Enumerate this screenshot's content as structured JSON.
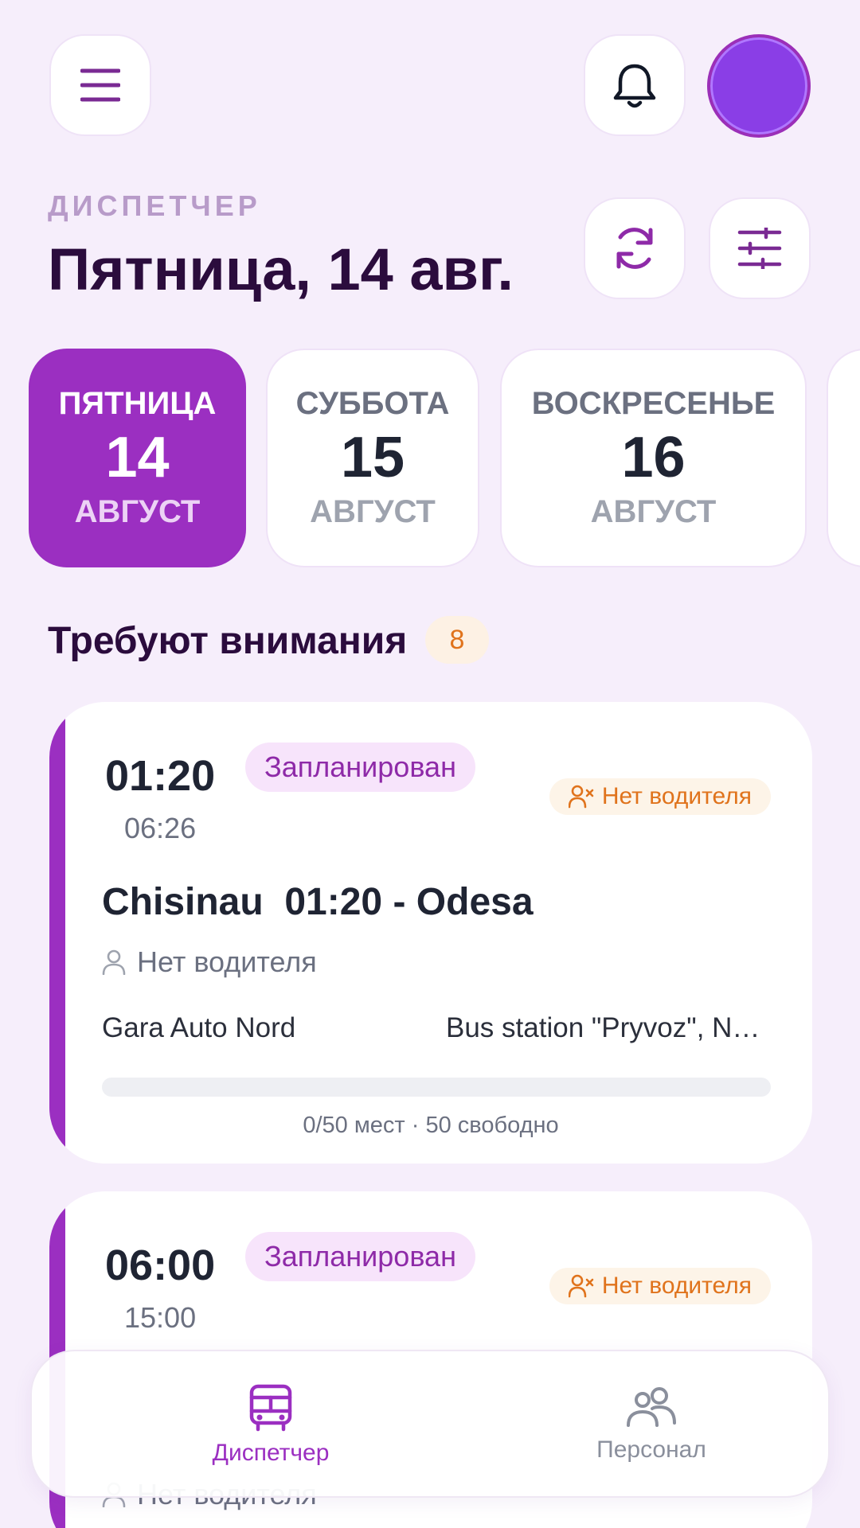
{
  "header": {
    "eyebrow": "ДИСПЕТЧЕР",
    "title": "Пятница, 14 авг.",
    "icons": [
      "menu-icon",
      "bell-icon",
      "refresh-icon",
      "sliders-icon"
    ],
    "avatar_color": "#8a3ee6"
  },
  "days": [
    {
      "name": "ПЯТНИЦА",
      "num": "14",
      "month": "АВГУСТ",
      "active": true
    },
    {
      "name": "СУББОТА",
      "num": "15",
      "month": "АВГУСТ",
      "active": false
    },
    {
      "name": "ВОСКРЕСЕНЬЕ",
      "num": "16",
      "month": "АВГУСТ",
      "active": false
    }
  ],
  "attention": {
    "title": "Требуют внимания",
    "count": "8"
  },
  "trips": [
    {
      "time": "01:20",
      "end_time": "06:26",
      "status": "Запланирован",
      "badge": "Нет водителя",
      "route": "Chisinau  01:20 - Odesa",
      "driver": "Нет водителя",
      "from": "Gara Auto Nord",
      "to": "Bus station \"Pryvoz\", Novoshchepnyi Riad Street",
      "seats_text": "0/50 мест · 50 свободно",
      "occupancy": 0
    },
    {
      "time": "06:00",
      "end_time": "15:00",
      "status": "Запланирован",
      "badge": "Нет водителя",
      "driver": "Нет водителя"
    }
  ],
  "nav": [
    {
      "label": "Диспетчер",
      "icon": "bus-icon",
      "active": true
    },
    {
      "label": "Персонал",
      "icon": "users-icon",
      "active": false
    }
  ],
  "colors": {
    "accent": "#9b2fc1",
    "background": "#f6eefb",
    "warning": "#e0731c"
  }
}
